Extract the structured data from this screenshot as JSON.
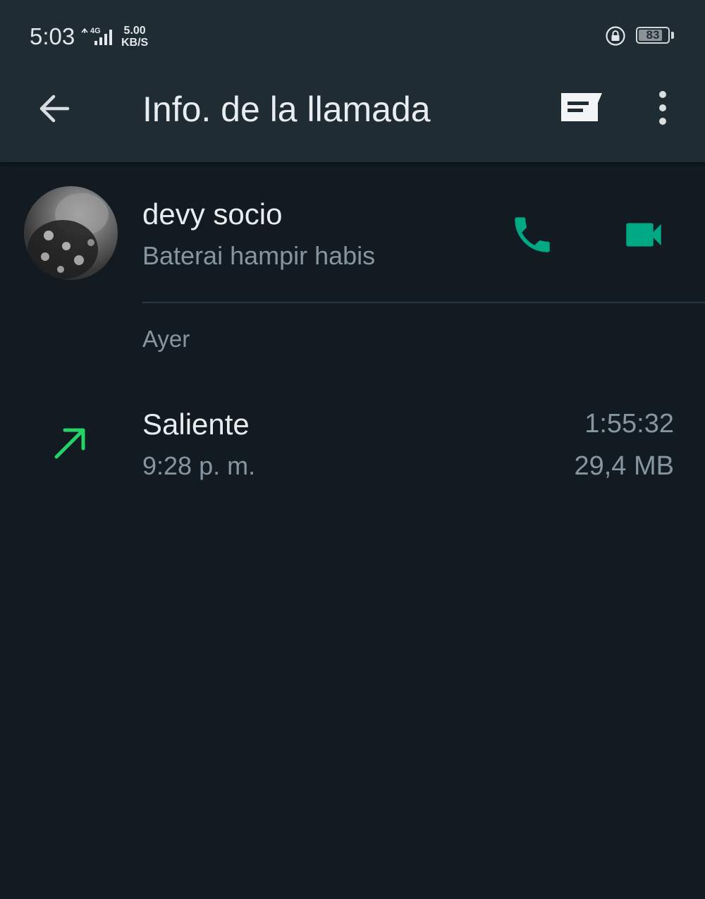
{
  "status_bar": {
    "time": "5:03",
    "network": "4G",
    "speed_value": "5.00",
    "speed_unit": "KB/S",
    "battery": "83",
    "battery_level": 0.83
  },
  "app_bar": {
    "title": "Info. de la llamada",
    "icons": [
      "back-arrow-icon",
      "message-icon",
      "more-vert-icon"
    ]
  },
  "contact": {
    "name": "devy socio",
    "status": "Baterai hampir habis",
    "actions": [
      "phone-icon",
      "video-camera-icon"
    ]
  },
  "call_log": {
    "date_header": "Ayer",
    "calls": [
      {
        "direction": "Saliente",
        "time": "9:28 p. m.",
        "duration": "1:55:32",
        "size": "29,4 MB",
        "icon": "outgoing-arrow-icon"
      }
    ]
  },
  "colors": {
    "background": "#121b22",
    "app_bar": "#1f2c34",
    "accent": "#00a884",
    "outgoing": "#25d366",
    "primary_text": "#e9edef",
    "secondary_text": "#8696a0"
  }
}
